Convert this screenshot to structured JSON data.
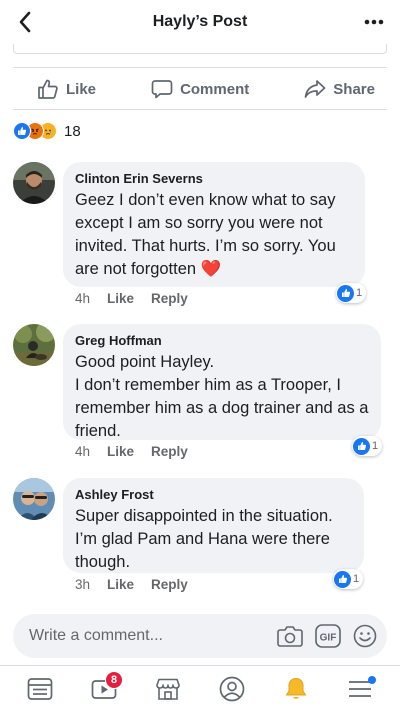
{
  "header": {
    "title": "Hayly’s Post"
  },
  "actions": [
    {
      "label": "Like",
      "icon": "thumbs-up-icon"
    },
    {
      "label": "Comment",
      "icon": "speech-bubble-icon"
    },
    {
      "label": "Share",
      "icon": "share-arrow-icon"
    }
  ],
  "reactions": {
    "types": [
      "like",
      "angry",
      "sad"
    ],
    "count": "18"
  },
  "comments": [
    {
      "author": "Clinton Erin Severns",
      "text": "Geez I don’t even know what to say except I am so sorry you were not invited. That hurts. I’m so sorry. You are not forgotten",
      "emoji": "❤️",
      "time": "4h",
      "like_label": "Like",
      "reply_label": "Reply",
      "reaction_count": "1"
    },
    {
      "author": "Greg Hoffman",
      "text": "Good point Hayley.\nI don’t remember him as a Trooper, I remember him as a dog trainer and as a friend.",
      "time": "4h",
      "like_label": "Like",
      "reply_label": "Reply",
      "reaction_count": "1"
    },
    {
      "author": "Ashley Frost",
      "text": "Super disappointed in the situation. I’m glad Pam and Hana were there though.",
      "time": "3h",
      "like_label": "Like",
      "reply_label": "Reply",
      "reaction_count": "1"
    }
  ],
  "composer": {
    "placeholder": "Write a comment...",
    "gif_label": "GIF"
  },
  "bottom_nav": {
    "items": [
      "news-feed-icon",
      "watch-video-icon",
      "marketplace-icon",
      "profile-icon",
      "notifications-bell-icon",
      "menu-icon"
    ],
    "video_badge": "8"
  },
  "colors": {
    "accent": "#1877f2",
    "bubble": "#f0f2f5",
    "badge_red": "#e41e3f",
    "muted": "#65676b"
  }
}
